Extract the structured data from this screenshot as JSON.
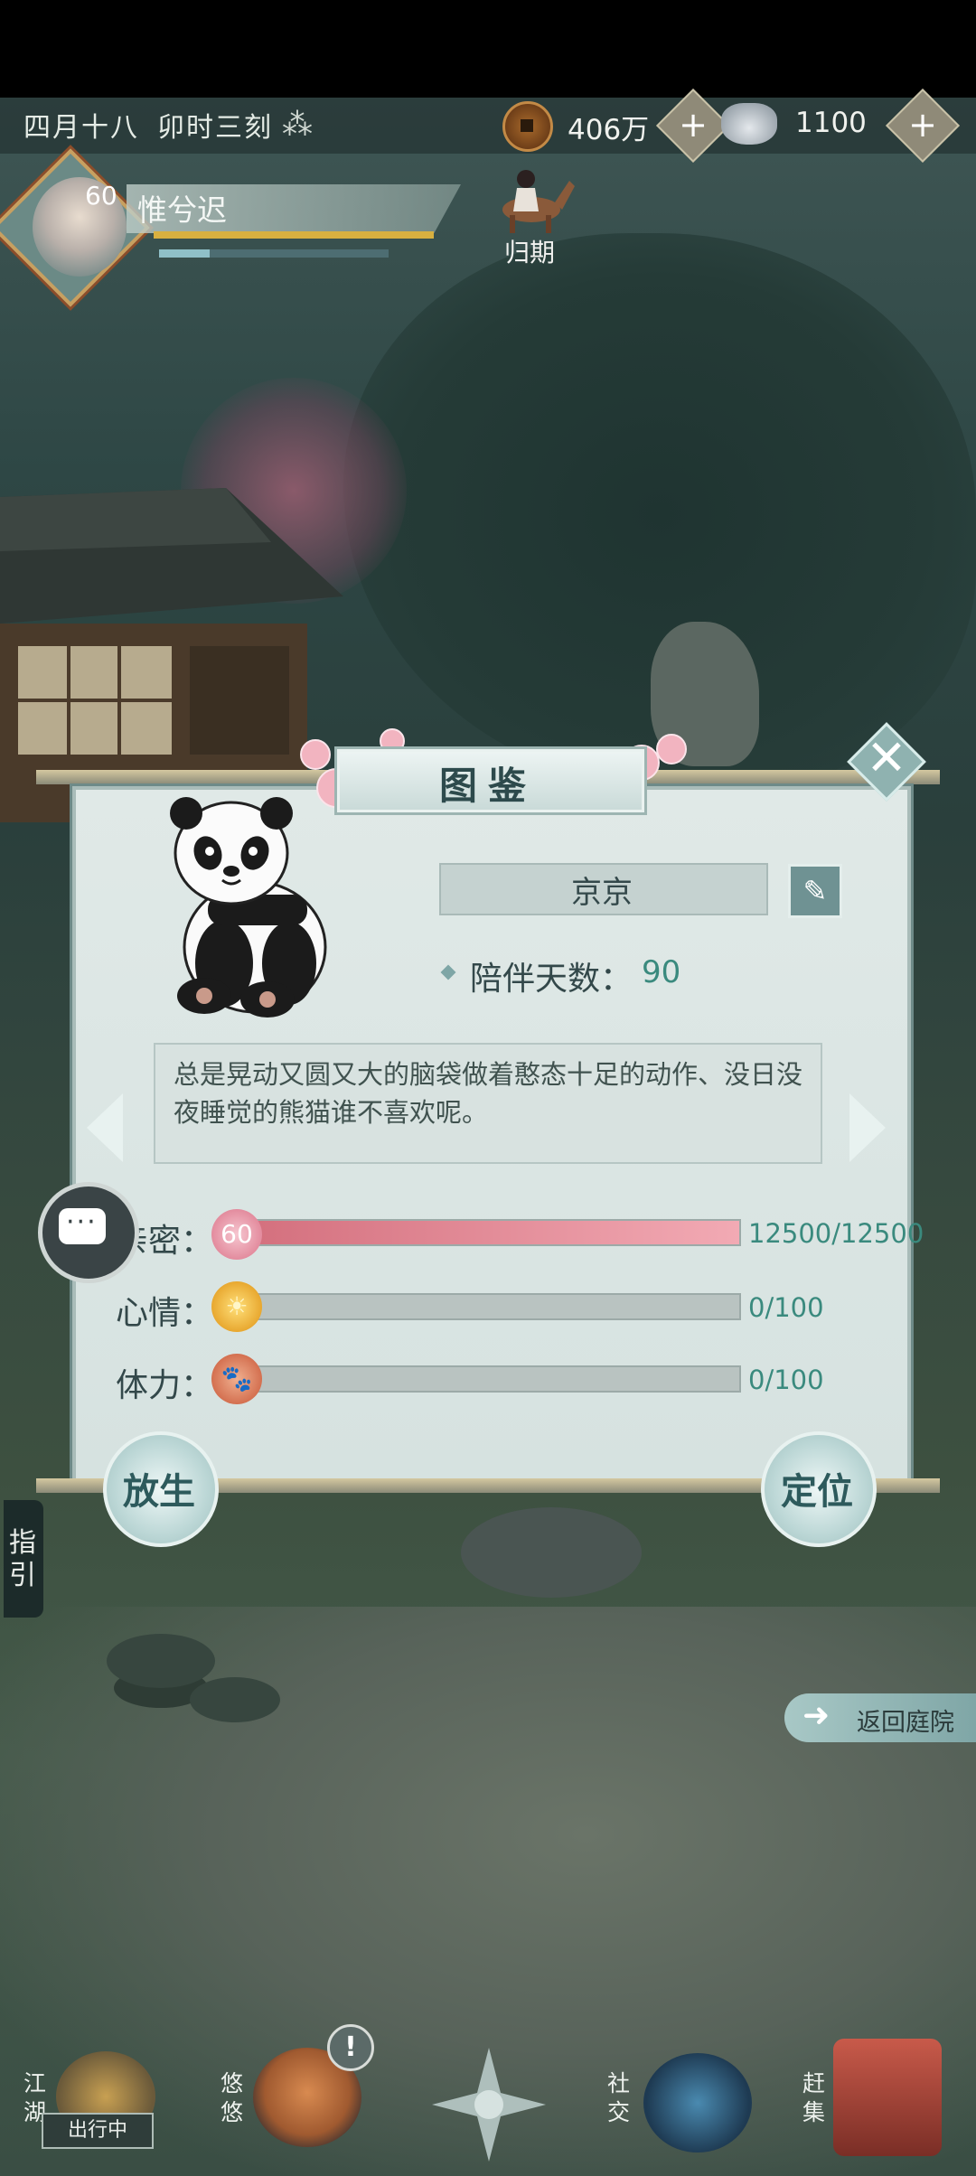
{
  "status": {
    "date": "四月十八",
    "time": "卯时三刻",
    "copper": "406万",
    "silver": "1100"
  },
  "player": {
    "level": "60",
    "name": "惟兮迟",
    "exp_fraction": 0.22
  },
  "companion": {
    "label": "归期"
  },
  "panel": {
    "title": "图鉴",
    "pet_name": "京京",
    "days_label": "陪伴天数：",
    "days_value": "90",
    "description": "总是晃动又圆又大的脑袋做着憨态十足的动作、没日没夜睡觉的熊猫谁不喜欢呢。",
    "stats": [
      {
        "label": "亲密：",
        "icon": "flower-icon",
        "icon_text": "60",
        "text": "12500/12500",
        "fraction": 1.0
      },
      {
        "label": "心情：",
        "icon": "sun-icon",
        "icon_text": "",
        "text": "0/100",
        "fraction": 0.0
      },
      {
        "label": "体力：",
        "icon": "paw-icon",
        "icon_text": "",
        "text": "0/100",
        "fraction": 0.0
      }
    ],
    "release_button": "放生",
    "locate_button": "定位"
  },
  "side": {
    "guide": "指引",
    "return_courtyard": "返回庭院"
  },
  "nav": {
    "jianghu": "江湖",
    "outgoing": "出行中",
    "youyou": "悠悠",
    "alert": "!",
    "social": "社交",
    "market": "赶集"
  },
  "colors": {
    "accent_teal": "#3a8a7e",
    "intimacy_bar": "#d4707e"
  }
}
